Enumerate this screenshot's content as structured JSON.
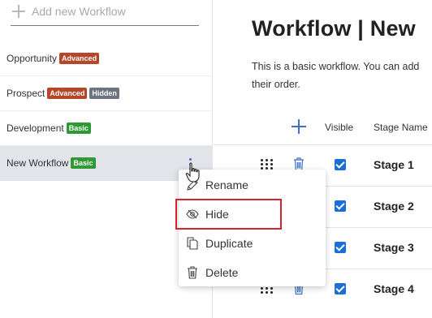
{
  "sidebar": {
    "add_label": "Add new Workflow",
    "items": [
      {
        "name": "Opportunity",
        "badges": [
          {
            "text": "Advanced",
            "kind": "advanced"
          }
        ]
      },
      {
        "name": "Prospect",
        "badges": [
          {
            "text": "Advanced",
            "kind": "advanced"
          },
          {
            "text": "Hidden",
            "kind": "hidden"
          }
        ]
      },
      {
        "name": "Development",
        "badges": [
          {
            "text": "Basic",
            "kind": "basic"
          }
        ]
      },
      {
        "name": "New Workflow",
        "badges": [
          {
            "text": "Basic",
            "kind": "basic"
          }
        ],
        "active": true
      }
    ]
  },
  "context_menu": {
    "items": [
      {
        "label": "Rename",
        "icon": "pencil-icon"
      },
      {
        "label": "Hide",
        "icon": "eye-slash-icon",
        "highlighted": true
      },
      {
        "label": "Duplicate",
        "icon": "copy-icon"
      },
      {
        "label": "Delete",
        "icon": "trash-icon"
      }
    ]
  },
  "main": {
    "title": "Workflow | New",
    "description_line1": "This is a basic workflow. You can add",
    "description_line2": "their order.",
    "table": {
      "col_visible": "Visible",
      "col_stage_name": "Stage Name",
      "rows": [
        {
          "name": "Stage 1",
          "visible": true
        },
        {
          "name": "Stage 2",
          "visible": true
        },
        {
          "name": "Stage 3",
          "visible": true
        },
        {
          "name": "Stage 4",
          "visible": true
        }
      ]
    }
  },
  "colors": {
    "advanced_badge": "#b5462a",
    "hidden_badge": "#6c757d",
    "basic_badge": "#2f9a35",
    "accent": "#1a6fd8",
    "highlight_border": "#d8222c"
  }
}
